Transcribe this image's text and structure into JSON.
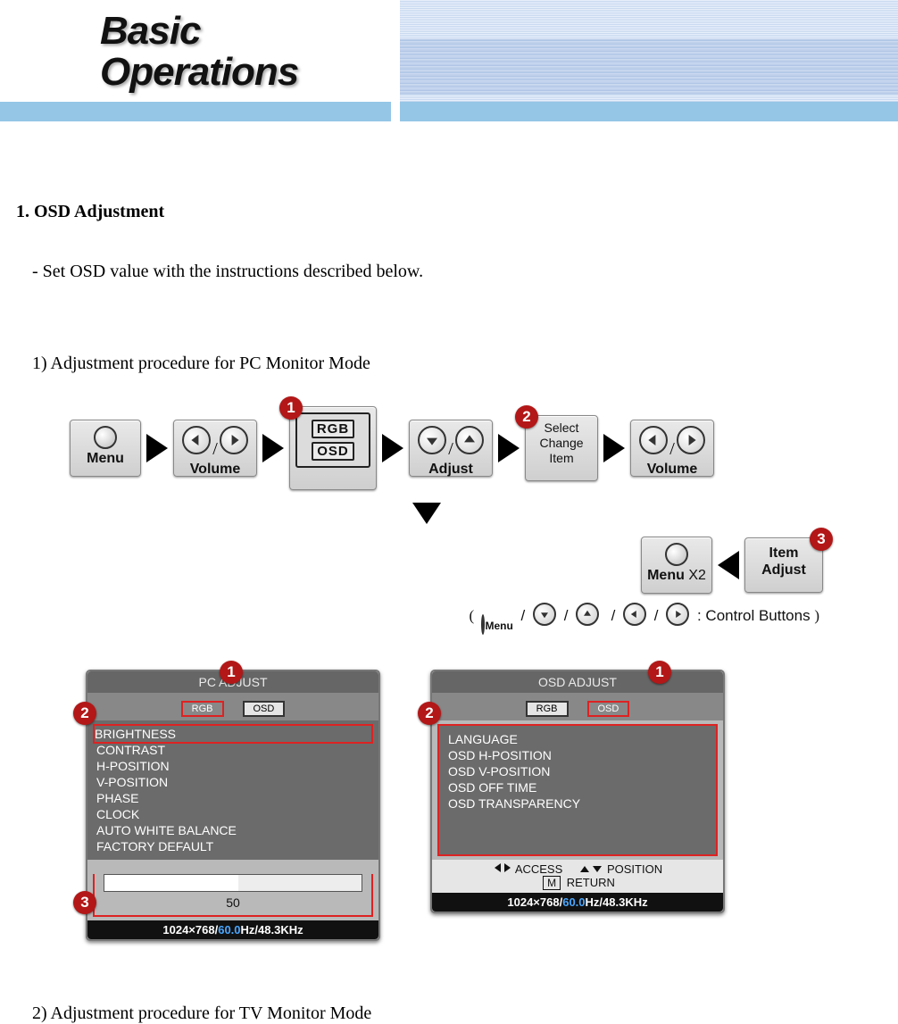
{
  "header": {
    "title_l1": "Basic",
    "title_l2": "Operations"
  },
  "section": {
    "h1": "1. OSD Adjustment",
    "intro": "- Set OSD value with the instructions described below.",
    "proc1": "1) Adjustment procedure   for PC Monitor Mode",
    "proc2": "2) Adjustment procedure for TV Monitor Mode"
  },
  "flow": {
    "menu": "Menu",
    "volume": "Volume",
    "adjust": "Adjust",
    "rgb": "RGB",
    "osd": "OSD",
    "select": "Select",
    "change": "Change",
    "item": "Item",
    "itemAdjust1": "Item",
    "itemAdjust2": "Adjust",
    "menuX2": "Menu",
    "controlButtons": ": Control Buttons",
    "badges": [
      "1",
      "2",
      "3"
    ]
  },
  "pc_adjust": {
    "title": "PC  ADJUST",
    "tabs": [
      "RGB",
      "OSD"
    ],
    "items": [
      "BRIGHTNESS",
      "CONTRAST",
      "H-POSITION",
      "V-POSITION",
      "PHASE",
      "CLOCK",
      "AUTO WHITE BALANCE",
      "FACTORY DEFAULT"
    ],
    "sliderValue": "50",
    "footer_res": "1024×768/",
    "footer_hz": "60.0",
    "footer_tail": "Hz/48.3KHz",
    "badges": [
      "1",
      "2",
      "3"
    ]
  },
  "osd_adjust": {
    "title": "OSD  ADJUST",
    "tabs": [
      "RGB",
      "OSD"
    ],
    "items": [
      "LANGUAGE",
      "OSD H-POSITION",
      "OSD V-POSITION",
      "OSD OFF TIME",
      "OSD TRANSPARENCY"
    ],
    "legend": {
      "access": "ACCESS",
      "position": "POSITION",
      "return": "RETURN",
      "mkey": "M"
    },
    "footer_res": "1024×768/",
    "footer_hz": "60.0",
    "footer_tail": "Hz/48.3KHz",
    "badges": [
      "1",
      "2"
    ]
  }
}
